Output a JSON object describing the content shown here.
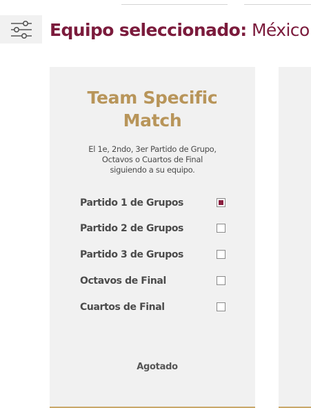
{
  "header": {
    "filter_icon": "sliders-filter-icon",
    "selected_team_label": "Equipo seleccionado:",
    "selected_team_value": " México"
  },
  "card": {
    "title_line1": "Team Specific",
    "title_line2": "Match",
    "description_line1": "El 1e, 2ndo, 3er Partido de Grupo,",
    "description_line2": "Octavos o Cuartos de Final",
    "description_line3": "siguiendo a su equipo.",
    "options": [
      {
        "label": "Partido 1 de Grupos",
        "checked": true
      },
      {
        "label": "Partido 2 de Grupos",
        "checked": false
      },
      {
        "label": "Partido 3 de Grupos",
        "checked": false
      },
      {
        "label": "Octavos de Final",
        "checked": false
      },
      {
        "label": "Cuartos de Final",
        "checked": false
      }
    ],
    "status": "Agotado"
  },
  "colors": {
    "brand_maroon": "#7b1b3c",
    "gold": "#b8955a",
    "card_bg": "#f1f1f1"
  }
}
